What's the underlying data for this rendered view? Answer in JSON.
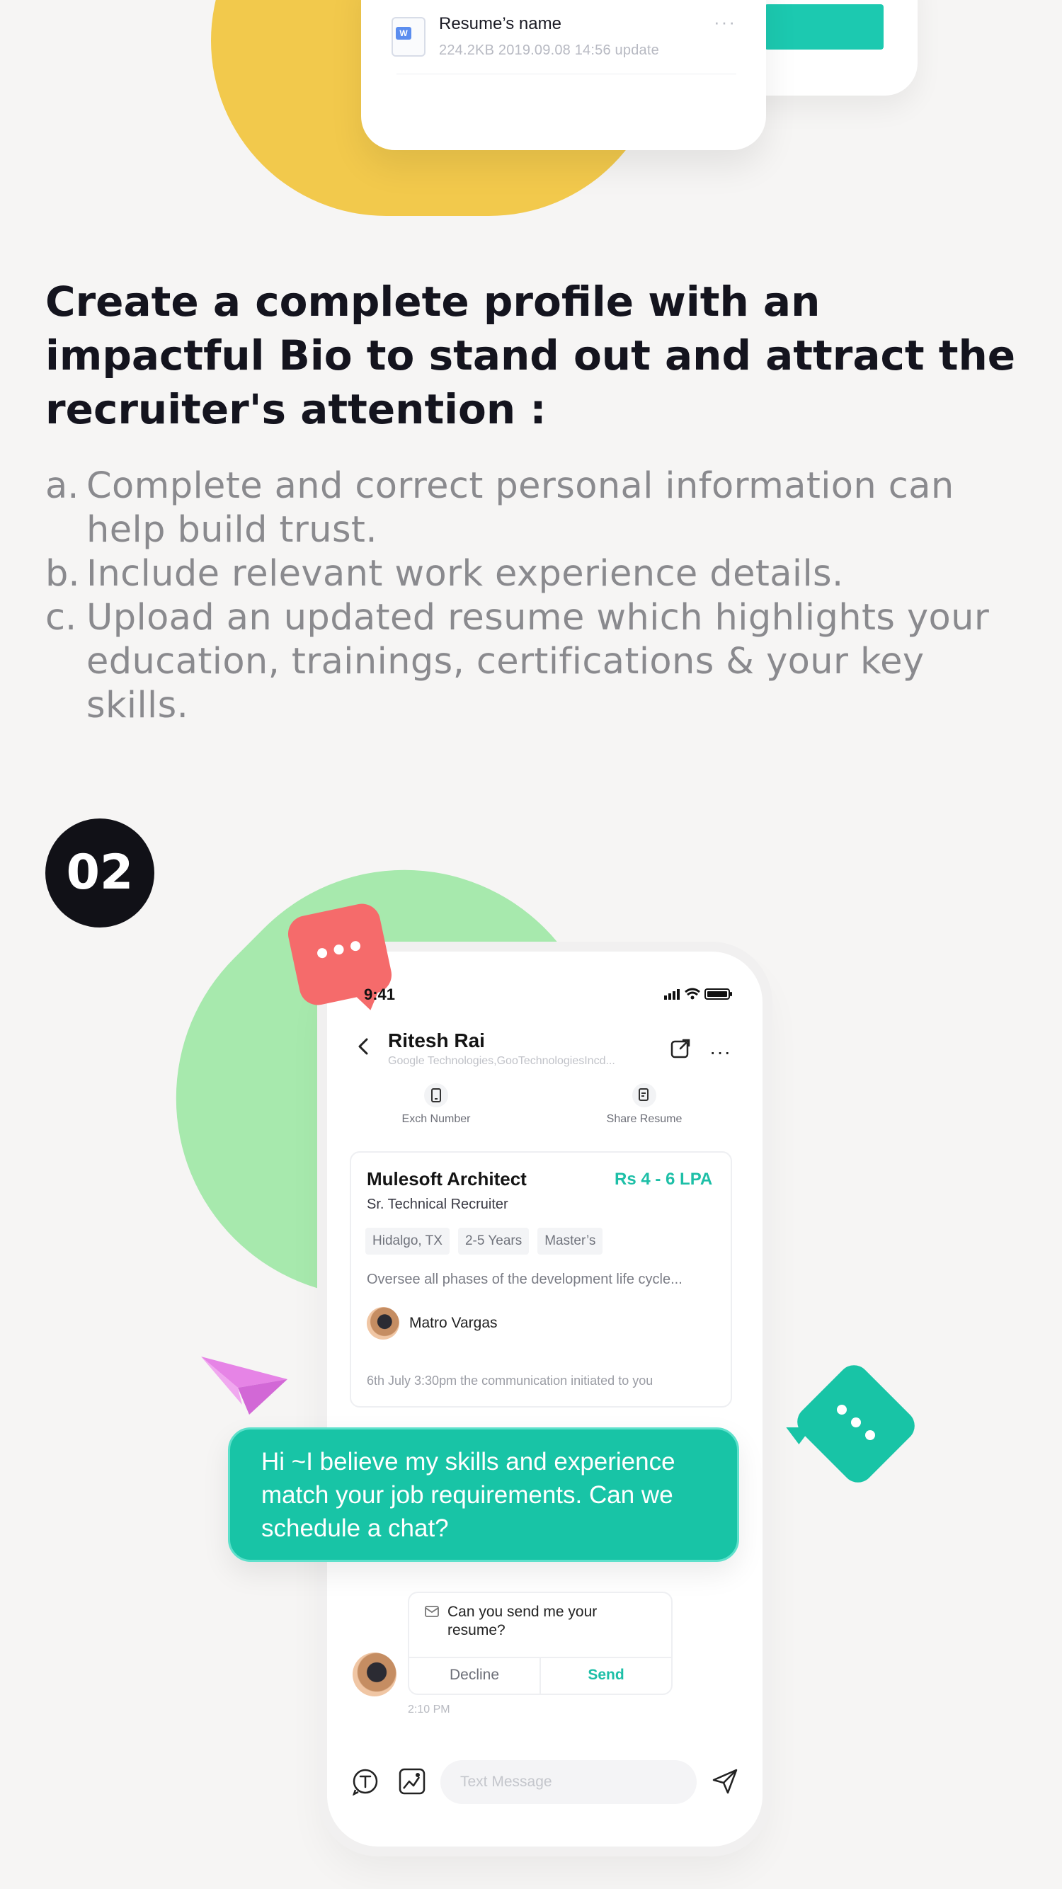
{
  "resume_card": {
    "name": "Resume’s name",
    "meta": "224.2KB   2019.09.08   14:56 update",
    "more": "···",
    "doc_badge": "W"
  },
  "section1": {
    "headline": "Create a complete profile with an impactful Bio to stand out and attract the recruiter's attention :",
    "bullets": [
      {
        "marker": "a.",
        "text": "Complete and correct personal information can help build trust."
      },
      {
        "marker": "b.",
        "text": "Include relevant work experience details."
      },
      {
        "marker": "c.",
        "text": "Upload an updated resume which highlights your education, trainings, certifications & your key skills."
      }
    ]
  },
  "step": {
    "number": "02"
  },
  "phone": {
    "status_time": "9:41",
    "header": {
      "name": "Ritesh Rai",
      "company": "Google Technologies,GooTechnologiesIncd..."
    },
    "actions": {
      "exch_number": "Exch Number",
      "share_resume": "Share Resume"
    },
    "job_card": {
      "title": "Mulesoft Architect",
      "salary": "Rs 4 - 6 LPA",
      "role": "Sr. Technical Recruiter",
      "tags": [
        "Hidalgo, TX",
        "2-5 Years",
        "Master’s"
      ],
      "description": "Oversee all phases of the development life cycle...",
      "recruiter": "Matro Vargas",
      "footer": "6th July 3:30pm the communication initiated to you"
    },
    "message": "Hi ~I believe my skills and experience match your job requirements. Can we schedule a chat?",
    "request": {
      "text": "Can you send me your resume?",
      "decline": "Decline",
      "send": "Send",
      "time": "2:10 PM"
    },
    "composer": {
      "placeholder": "Text Message"
    }
  },
  "colors": {
    "accent_teal": "#18c4a6",
    "yellow": "#f2c94c",
    "green": "#a7e9ad",
    "red": "#f56b6b"
  }
}
